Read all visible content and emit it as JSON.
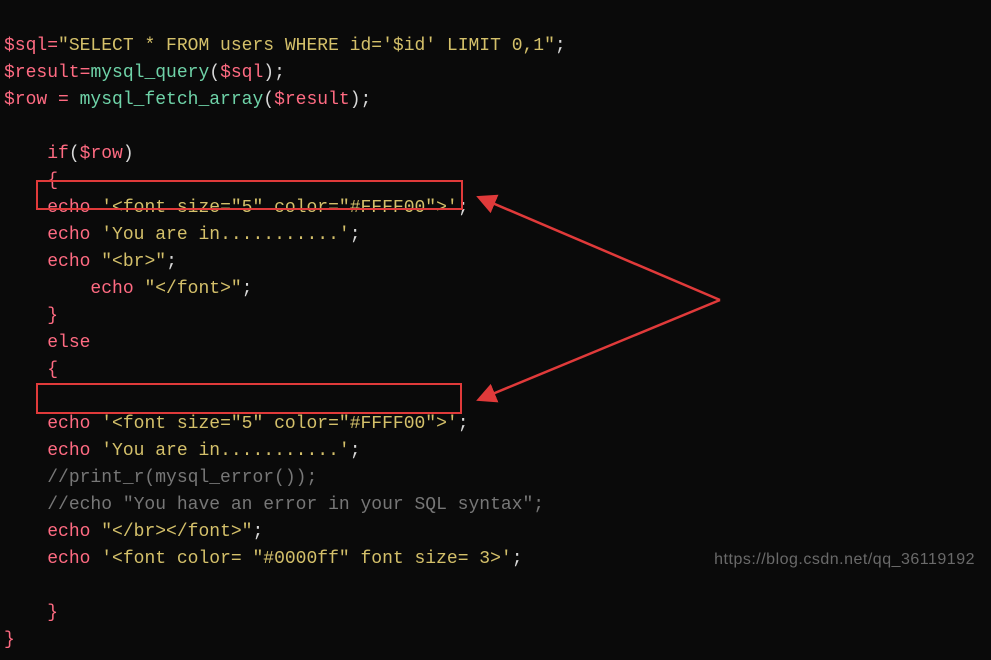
{
  "code": {
    "line1_var": "$sql",
    "line1_eq": "=",
    "line1_str": "\"SELECT * FROM users WHERE id='$id' LIMIT 0,1\"",
    "line1_semi": ";",
    "line2_var": "$result",
    "line2_eq": "=",
    "line2_func": "mysql_query",
    "line2_open": "(",
    "line2_arg": "$sql",
    "line2_close_semi": ");",
    "line3_var": "$row",
    "line3_eq": " = ",
    "line3_func": "mysql_fetch_array",
    "line3_open": "(",
    "line3_arg": "$result",
    "line3_close_semi": ");",
    "if_kw": "if",
    "if_open": "(",
    "if_arg": "$row",
    "if_close": ")",
    "brace_open": "{",
    "brace_close": "}",
    "echo_kw": "echo",
    "font_open_str": "'<font size=\"5\" color=\"#FFFF00\">'",
    "semi": ";",
    "you_in_str": "'You are in...........'",
    "br_open_str": "\"<br>\"",
    "font_close_str": "\"</font>\"",
    "else_kw": "else",
    "comment1": "//print_r(mysql_error());",
    "comment2": "//echo \"You have an error in your SQL syntax\";",
    "br_font_close_str": "\"</br></font>\"",
    "font_blue_str": "'<font color= \"#0000ff\" font size= 3>'"
  },
  "watermark": "https://blog.csdn.net/qq_36119192"
}
